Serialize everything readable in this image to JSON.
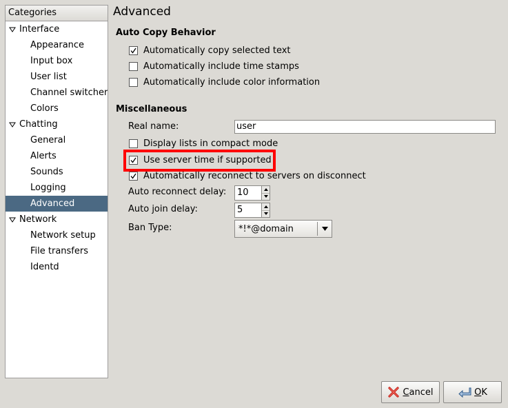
{
  "sidebar": {
    "header": "Categories",
    "items": [
      {
        "label": "Interface",
        "type": "category"
      },
      {
        "label": "Appearance",
        "type": "sub"
      },
      {
        "label": "Input box",
        "type": "sub"
      },
      {
        "label": "User list",
        "type": "sub"
      },
      {
        "label": "Channel switcher",
        "type": "sub"
      },
      {
        "label": "Colors",
        "type": "sub"
      },
      {
        "label": "Chatting",
        "type": "category"
      },
      {
        "label": "General",
        "type": "sub"
      },
      {
        "label": "Alerts",
        "type": "sub"
      },
      {
        "label": "Sounds",
        "type": "sub"
      },
      {
        "label": "Logging",
        "type": "sub"
      },
      {
        "label": "Advanced",
        "type": "sub",
        "selected": true
      },
      {
        "label": "Network",
        "type": "category"
      },
      {
        "label": "Network setup",
        "type": "sub"
      },
      {
        "label": "File transfers",
        "type": "sub"
      },
      {
        "label": "Identd",
        "type": "sub"
      }
    ]
  },
  "main": {
    "title": "Advanced",
    "auto_copy": {
      "heading": "Auto Copy Behavior",
      "options": [
        {
          "label": "Automatically copy selected text",
          "checked": true
        },
        {
          "label": "Automatically include time stamps",
          "checked": false
        },
        {
          "label": "Automatically include color information",
          "checked": false
        }
      ]
    },
    "misc": {
      "heading": "Miscellaneous",
      "real_name_label": "Real name:",
      "real_name_value": "user",
      "options": [
        {
          "label": "Display lists in compact mode",
          "checked": false
        },
        {
          "label": "Use server time if supported",
          "checked": true
        },
        {
          "label": "Automatically reconnect to servers on disconnect",
          "checked": true
        }
      ],
      "reconnect_label": "Auto reconnect delay:",
      "reconnect_value": "10",
      "join_label": "Auto join delay:",
      "join_value": "5",
      "ban_label": "Ban Type:",
      "ban_value": "*!*@domain"
    }
  },
  "buttons": {
    "cancel_label": "Cancel",
    "cancel_mnemonic": "C",
    "cancel_rest": "ancel",
    "ok_label": "OK",
    "ok_mnemonic": "O",
    "ok_rest": "K"
  },
  "colors": {
    "highlight": "#ff0000",
    "selection": "#4b6983"
  }
}
